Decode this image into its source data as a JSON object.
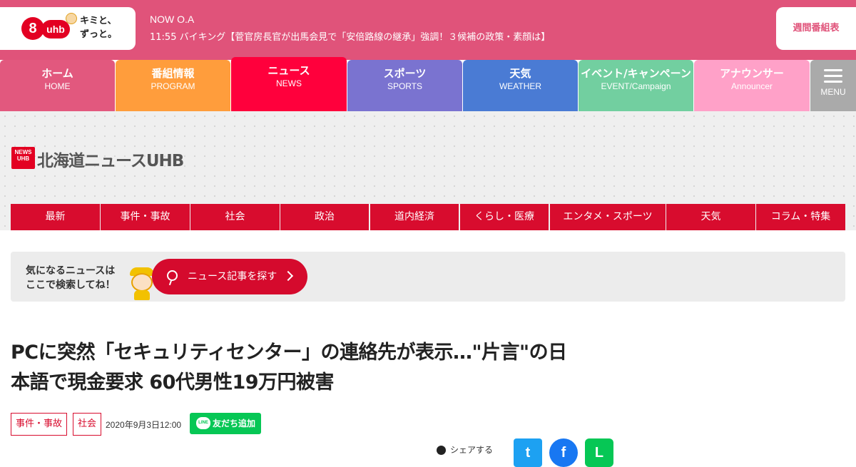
{
  "header": {
    "channel_number": "8",
    "brand": "uhb",
    "slogan_line1": "キミと、",
    "slogan_line2": "ずっと。",
    "now_oa_label": "NOW O.A",
    "now_oa_text": "11:55 バイキング【菅官房長官が出馬会見で「安倍路線の継承」強調！３候補の政策・素顔は】",
    "weekly_schedule": "週間番組表"
  },
  "main_nav": [
    {
      "jp": "ホーム",
      "en": "HOME",
      "color": "#e2587e"
    },
    {
      "jp": "番組情報",
      "en": "PROGRAM",
      "color": "#ff9d3c"
    },
    {
      "jp": "ニュース",
      "en": "NEWS",
      "color": "#ff003c"
    },
    {
      "jp": "スポーツ",
      "en": "SPORTS",
      "color": "#7a73d0"
    },
    {
      "jp": "天気",
      "en": "WEATHER",
      "color": "#4a7bd4"
    },
    {
      "jp": "イベント/キャンペーン",
      "en": "EVENT/Campaign",
      "color": "#72cfa0"
    },
    {
      "jp": "アナウンサー",
      "en": "Announcer",
      "color": "#ffa1c8"
    }
  ],
  "menu_label": "MENU",
  "news_logo": {
    "mark_line1": "NEWS",
    "mark_line2": "UHB",
    "text": "北海道ニュースUHB"
  },
  "sub_nav": [
    "最新",
    "事件・事故",
    "社会",
    "政治",
    "道内経済",
    "くらし・医療",
    "エンタメ・スポーツ",
    "天気",
    "コラム・特集"
  ],
  "search_banner": {
    "hint_line1": "気になるニュースは",
    "hint_line2": "ここで検索してね！",
    "button_label": "ニュース記事を探す"
  },
  "article": {
    "title_line1": "PCに突然「セキュリティセンター」の連絡先が表示…\"片言\"の日",
    "title_line2": "本語で現金要求 60代男性19万円被害",
    "tags": [
      "事件・事故",
      "社会"
    ],
    "date": "2020年9月3日12:00",
    "line_add_friend": "友だち追加",
    "line_icon_text": "LINE"
  },
  "share": {
    "label": "シェアする"
  },
  "colors": {
    "topbar": "#e0537a",
    "accent_red": "#d80c2e",
    "line_green": "#06c755"
  }
}
